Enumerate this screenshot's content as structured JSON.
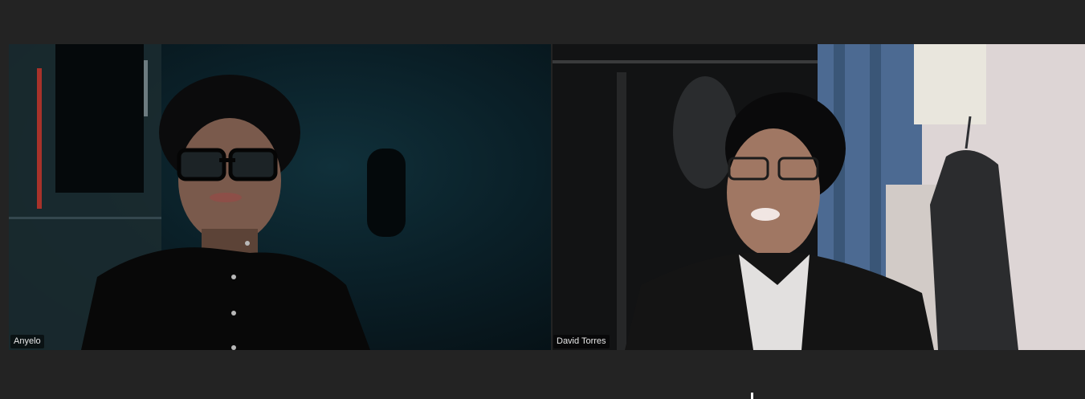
{
  "participants": [
    {
      "name": "Anyelo"
    },
    {
      "name": "David Torres"
    }
  ],
  "colors": {
    "background": "#232323",
    "label_bg": "#000000",
    "label_text": "#e8e8e8"
  }
}
